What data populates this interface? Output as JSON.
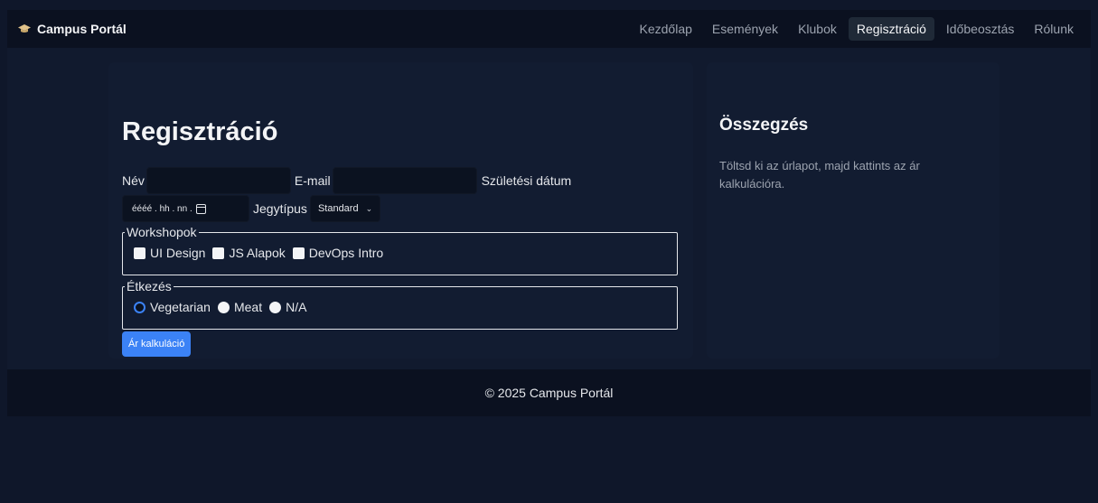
{
  "brand": {
    "icon": "graduation-cap-icon",
    "title": "Campus Portál"
  },
  "nav": {
    "items": [
      {
        "label": "Kezdőlap",
        "active": false
      },
      {
        "label": "Események",
        "active": false
      },
      {
        "label": "Klubok",
        "active": false
      },
      {
        "label": "Regisztráció",
        "active": true
      },
      {
        "label": "Időbeosztás",
        "active": false
      },
      {
        "label": "Rólunk",
        "active": false
      }
    ]
  },
  "form": {
    "title": "Regisztráció",
    "name_label": "Név",
    "name_value": "",
    "email_label": "E-mail",
    "email_value": "",
    "birth_label": "Születési dátum",
    "birth_placeholder": "éééé . hh . nn .",
    "ticket_label": "Jegytípus",
    "ticket_selected": "Standard",
    "workshops": {
      "legend": "Workshopok",
      "options": [
        {
          "label": "UI Design",
          "checked": false
        },
        {
          "label": "JS Alapok",
          "checked": false
        },
        {
          "label": "DevOps Intro",
          "checked": false
        }
      ]
    },
    "meals": {
      "legend": "Étkezés",
      "options": [
        {
          "label": "Vegetarian",
          "selected": true
        },
        {
          "label": "Meat",
          "selected": false
        },
        {
          "label": "N/A",
          "selected": false
        }
      ]
    },
    "calc_button": "Ár kalkuláció"
  },
  "summary": {
    "title": "Összegzés",
    "text": "Töltsd ki az úrlapot, majd kattints az ár kalkulációra."
  },
  "footer": {
    "text": "© 2025 Campus Portál"
  },
  "colors": {
    "accent": "#3b82f6",
    "background": "#0f172a",
    "navbar": "#0b1120"
  }
}
